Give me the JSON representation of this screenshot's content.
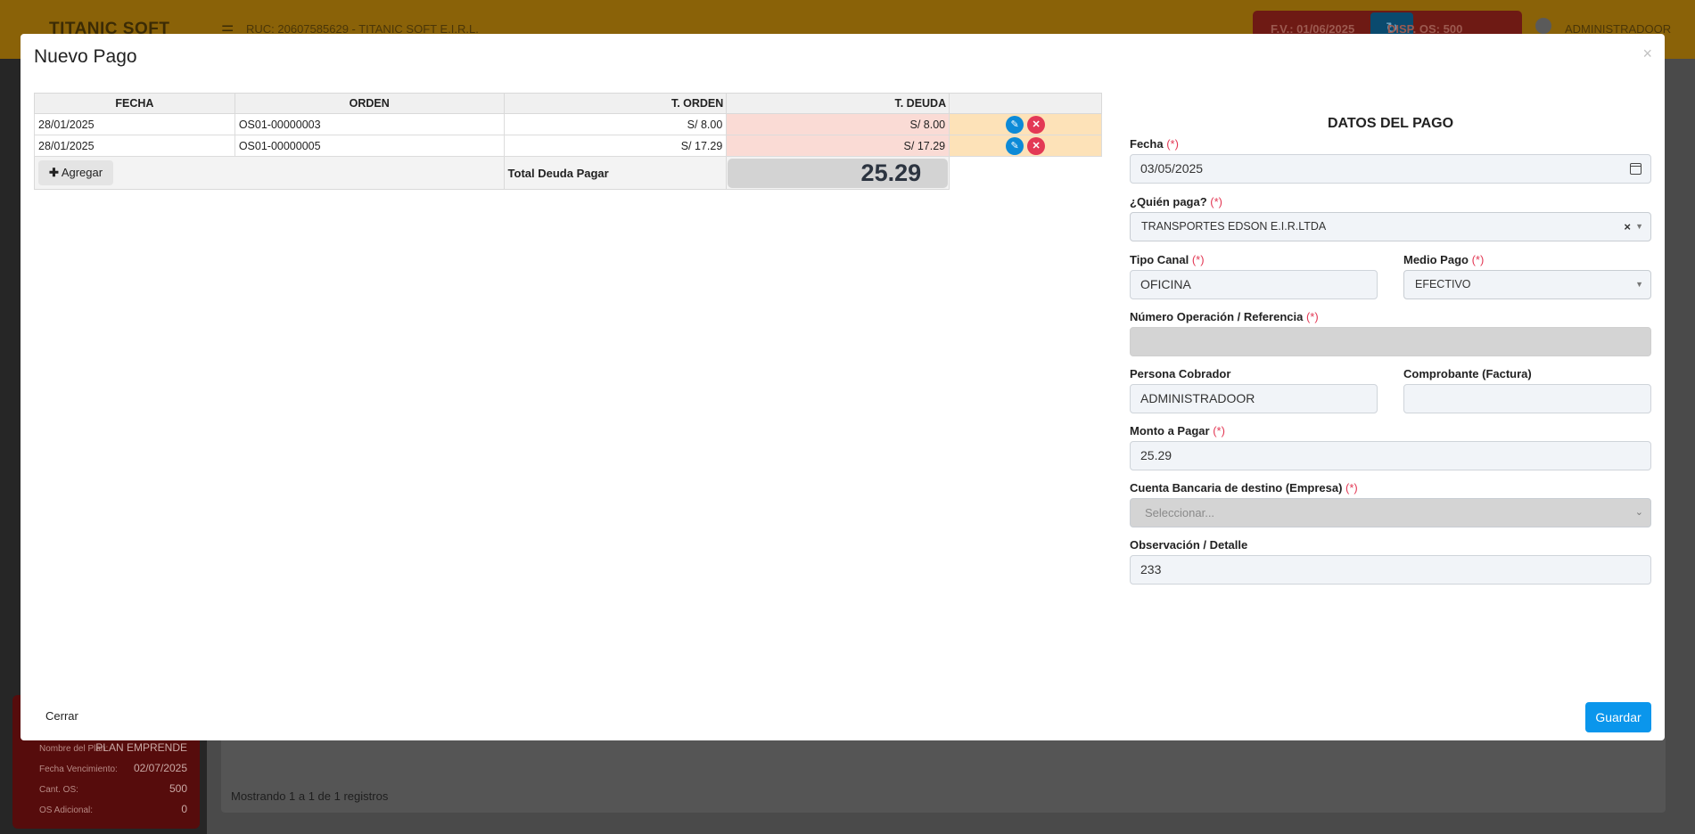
{
  "background": {
    "logo": "TITANIC SOFT",
    "ruc": "RUC: 20607585629 - TITANIC SOFT E.I.R.L.",
    "fv": "F.V.: 01/06/2025",
    "disp": "DISP. OS: 500",
    "user": "ADMINISTRADOOR",
    "plan": [
      {
        "key": "Nombre del Plan:",
        "value": "PLAN EMPRENDE"
      },
      {
        "key": "Fecha Vencimiento:",
        "value": "02/07/2025"
      },
      {
        "key": "Cant. OS:",
        "value": "500"
      },
      {
        "key": "OS Adicional:",
        "value": "0"
      }
    ],
    "showing": "Mostrando 1 a 1 de 1 registros"
  },
  "modal": {
    "title": "Nuevo Pago",
    "close": "×",
    "table": {
      "headers": [
        "FECHA",
        "ORDEN",
        "T. ORDEN",
        "T. DEUDA"
      ],
      "rows": [
        {
          "fecha": "28/01/2025",
          "orden": "OS01-00000003",
          "t_orden": "S/ 8.00",
          "t_deuda": "S/ 8.00"
        },
        {
          "fecha": "28/01/2025",
          "orden": "OS01-00000005",
          "t_orden": "S/ 17.29",
          "t_deuda": "S/ 17.29"
        }
      ],
      "add_label": "Agregar",
      "total_label": "Total Deuda Pagar",
      "total_value": "25.29"
    },
    "form": {
      "title": "DATOS DEL PAGO",
      "required_mark": "(*)",
      "fecha_label": "Fecha",
      "fecha_value": "03/05/2025",
      "quien_label": "¿Quién paga?",
      "quien_value": "TRANSPORTES EDSON E.I.R.LTDA",
      "tipo_canal_label": "Tipo Canal",
      "tipo_canal_value": "OFICINA",
      "medio_pago_label": "Medio Pago",
      "medio_pago_value": "EFECTIVO",
      "num_op_label": "Número Operación / Referencia",
      "num_op_value": "",
      "cobrador_label": "Persona Cobrador",
      "cobrador_value": "ADMINISTRADOOR",
      "comprobante_label": "Comprobante (Factura)",
      "comprobante_value": "",
      "monto_label": "Monto a Pagar",
      "monto_value": "25.29",
      "cuenta_label": "Cuenta Bancaria de destino (Empresa)",
      "cuenta_placeholder": "Seleccionar...",
      "obs_label": "Observación / Detalle",
      "obs_value": "233"
    },
    "cerrar_label": "Cerrar",
    "guardar_label": "Guardar"
  }
}
